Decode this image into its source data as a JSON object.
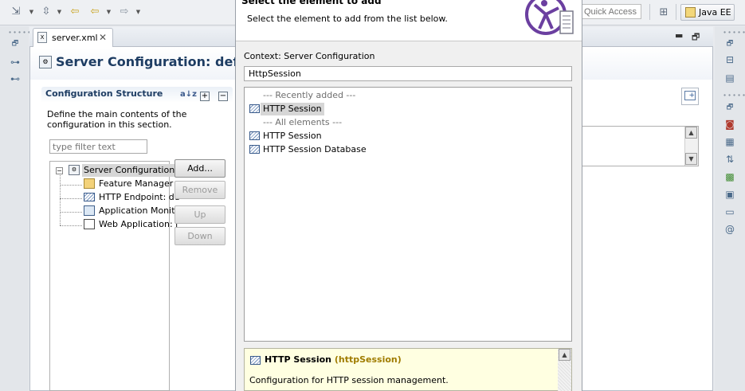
{
  "toolbar": {
    "quick_access_placeholder": "Quick Access",
    "perspective_label": "Java EE"
  },
  "editor": {
    "tab_label": "server.xml",
    "form_title": "Server Configuration: default"
  },
  "section": {
    "title": "Configuration Structure",
    "description": "Define the main contents of the configuration in this section.",
    "filter_placeholder": "type filter text",
    "sort_icon_text": "a↓z"
  },
  "tree": {
    "root": "Server Configuration",
    "children": [
      "Feature Manager",
      "HTTP Endpoint: de",
      "Application Monito",
      "Web Application: j"
    ]
  },
  "buttons": {
    "add": "Add...",
    "remove": "Remove",
    "up": "Up",
    "down": "Down"
  },
  "dialog": {
    "title": "Select the element to add",
    "subtitle": "Select the element to add from the list below.",
    "context_label": "Context: Server Configuration",
    "search_value": "HttpSession",
    "list": {
      "recent_heading": "--- Recently added ---",
      "recent_items": [
        "HTTP Session"
      ],
      "all_heading": "--- All elements ---",
      "all_items": [
        "HTTP Session",
        "HTTP Session Database"
      ]
    },
    "detail": {
      "name": "HTTP Session",
      "id": "(httpSession)",
      "description": "Configuration for HTTP session management."
    }
  }
}
